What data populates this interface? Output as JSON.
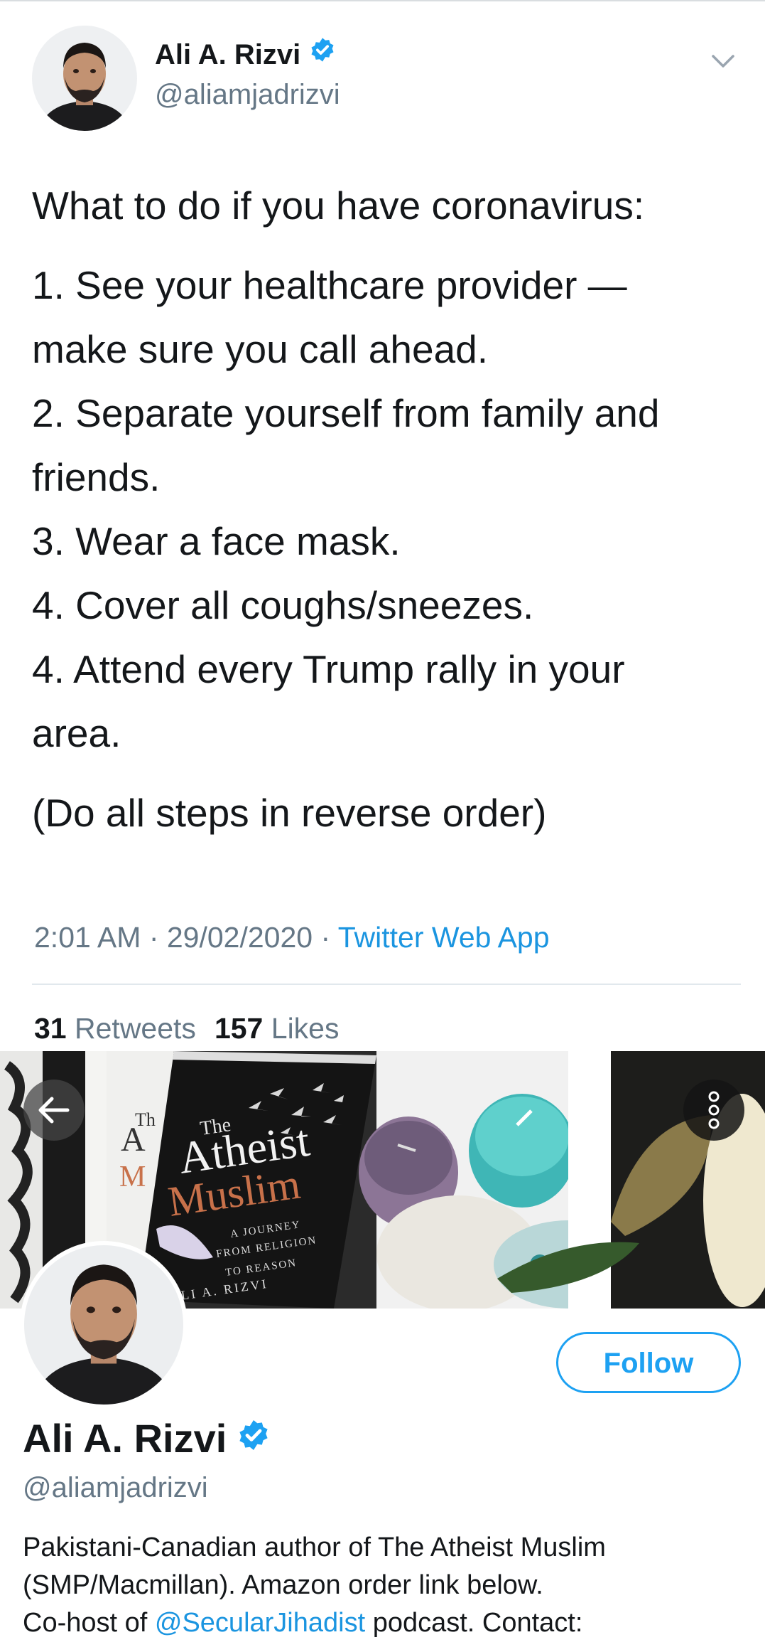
{
  "tweet": {
    "author_name": "Ali A. Rizvi",
    "author_handle": "@aliamjadrizvi",
    "lines": [
      "What to do if you have coronavirus:",
      "1. See your healthcare provider —",
      "make sure you call ahead.",
      "2. Separate yourself from family and",
      "friends.",
      "3. Wear a face mask.",
      "4. Cover all coughs/sneezes.",
      "4. Attend every Trump rally in your",
      "area.",
      "(Do all steps in reverse order)"
    ],
    "timestamp": "2:01 AM · 29/02/2020 · ",
    "source": "Twitter Web App",
    "retweets_count": "31",
    "retweets_label": "Retweets",
    "likes_count": "157",
    "likes_label": "Likes"
  },
  "banner": {
    "book_title_the": "The",
    "book_title_atheist": "Atheist",
    "book_title_muslim": "Muslim",
    "book_subtitle": [
      "A JOURNEY",
      "FROM RELIGION",
      "TO REASON"
    ],
    "book_author": "ALI A. RIZVI",
    "back_book_letters": [
      "Th",
      "A",
      "M"
    ]
  },
  "profile": {
    "name": "Ali A. Rizvi",
    "handle": "@aliamjadrizvi",
    "follow_label": "Follow",
    "bio_line1": "Pakistani-Canadian author of The Atheist Muslim",
    "bio_line2": "(SMP/Macmillan). Amazon order link below.",
    "bio_line3_prefix": "Co-host of ",
    "bio_line3_mention": "@SecularJihadist",
    "bio_line3_suffix": " podcast. Contact:"
  },
  "colors": {
    "verified": "#1da1f2",
    "link": "#1b95e0",
    "secondary_text": "#657786",
    "accent_book": "#c8714a"
  },
  "icons": [
    "verified-badge-icon",
    "chevron-down-icon",
    "back-arrow-icon",
    "more-options-icon"
  ]
}
